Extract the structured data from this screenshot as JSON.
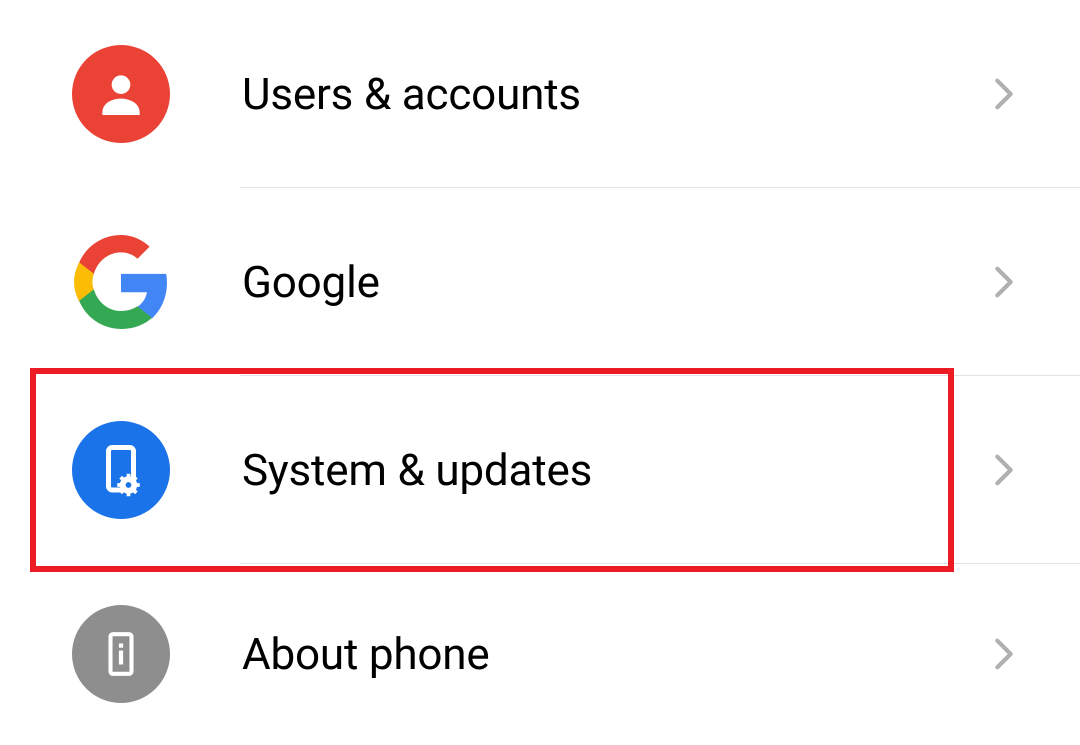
{
  "settings": {
    "items": [
      {
        "label": "Users & accounts",
        "icon": "person-icon",
        "color": "#ea4335"
      },
      {
        "label": "Google",
        "icon": "google-logo-icon",
        "color": "multi"
      },
      {
        "label": "System & updates",
        "icon": "phone-gear-icon",
        "color": "#1a73e8",
        "highlighted": true
      },
      {
        "label": "About phone",
        "icon": "phone-info-icon",
        "color": "#8e8e8e"
      }
    ]
  }
}
